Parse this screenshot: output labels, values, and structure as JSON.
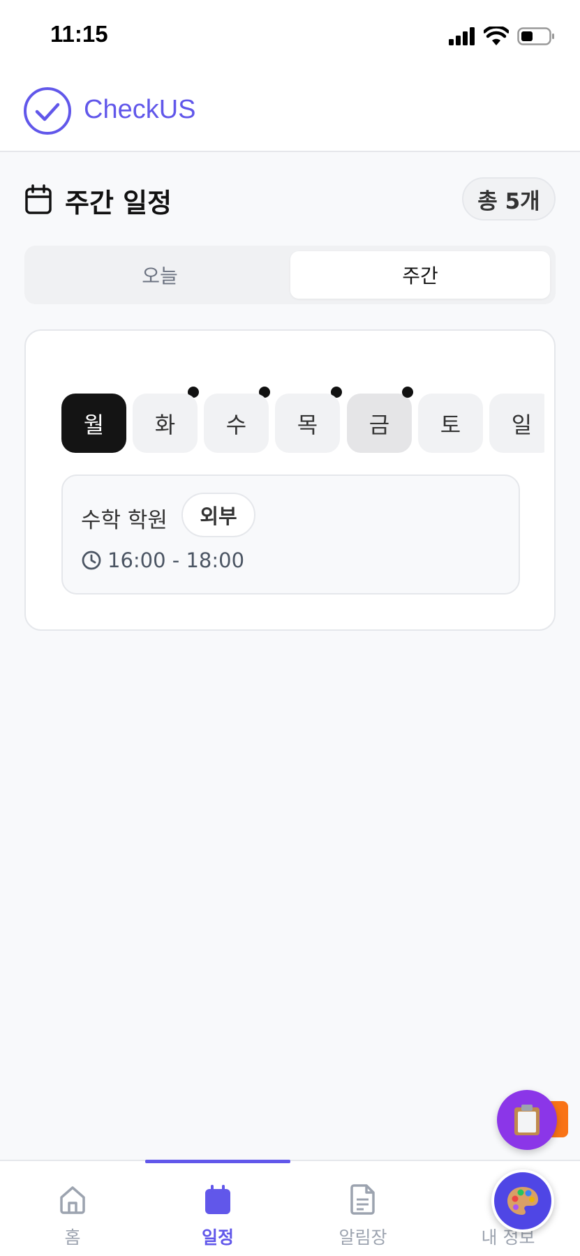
{
  "status_bar": {
    "time": "11:15"
  },
  "header": {
    "brand": "CheckUS",
    "accent": "#6157ea"
  },
  "schedule": {
    "title": "주간 일정",
    "count_label": "총 5개",
    "tabs": [
      {
        "label": "오늘",
        "selected": false
      },
      {
        "label": "주간",
        "selected": true
      }
    ],
    "days": [
      {
        "label": "월",
        "selected": true,
        "has_event_dot": false
      },
      {
        "label": "화",
        "selected": false,
        "has_event_dot": true
      },
      {
        "label": "수",
        "selected": false,
        "has_event_dot": true
      },
      {
        "label": "목",
        "selected": false,
        "has_event_dot": true
      },
      {
        "label": "금",
        "selected": false,
        "has_event_dot": true,
        "today": true
      },
      {
        "label": "토",
        "selected": false,
        "has_event_dot": false
      },
      {
        "label": "일",
        "selected": false,
        "has_event_dot": false
      }
    ],
    "events": [
      {
        "title": "수학 학원",
        "tag": "외부",
        "time": "16:00 - 18:00"
      }
    ]
  },
  "floating": {
    "task_fab_icon": "clipboard-icon",
    "theme_fab_icon": "palette-icon"
  },
  "bottom_nav": {
    "items": [
      {
        "label": "홈",
        "icon": "home-icon",
        "active": false
      },
      {
        "label": "일정",
        "icon": "calendar-icon",
        "active": true
      },
      {
        "label": "알림장",
        "icon": "document-icon",
        "active": false
      },
      {
        "label": "내 정보",
        "icon": "user-icon",
        "active": false
      }
    ]
  }
}
